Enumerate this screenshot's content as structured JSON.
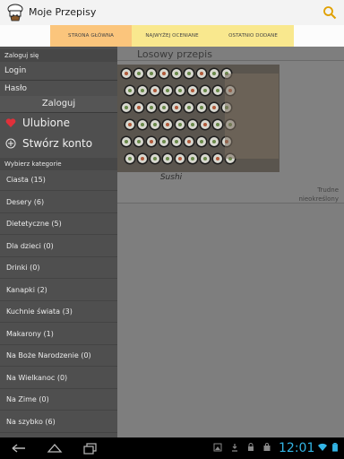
{
  "app": {
    "title": "Moje Przepisy",
    "icon": "chef-hat-icon"
  },
  "tabs": [
    {
      "label": "STRONA GŁÓWNA",
      "selected": true
    },
    {
      "label": "NAJWYŻEJ OCENIANE",
      "selected": false
    },
    {
      "label": "OSTATNIO DODANE",
      "selected": false
    }
  ],
  "main": {
    "section_title": "Losowy przepis",
    "recipe": {
      "name": "Sushi",
      "difficulty": "Trudne",
      "cuisine": "nieokreślony"
    }
  },
  "drawer": {
    "login_header": "Zaloguj się",
    "login_placeholder": "Login",
    "password_placeholder": "Hasło",
    "login_button": "Zaloguj",
    "favorites": "Ulubione",
    "create_account": "Stwórz konto",
    "categories_header": "Wybierz kategorie",
    "categories": [
      "Ciasta (15)",
      "Desery (6)",
      "Dietetyczne (5)",
      "Dla dzieci (0)",
      "Drinki (0)",
      "Kanapki (2)",
      "Kuchnie świata (3)",
      "Makarony (1)",
      "Na Boże Narodzenie (0)",
      "Na Wielkanoc (0)",
      "Na Zime (0)",
      "Na szybko (6)"
    ]
  },
  "statusbar": {
    "time": "12:01"
  },
  "colors": {
    "tab_selected": "#fbc57c",
    "tab_unselected": "#f9e88e",
    "clock": "#33b5e5",
    "heart": "#e0303a"
  }
}
